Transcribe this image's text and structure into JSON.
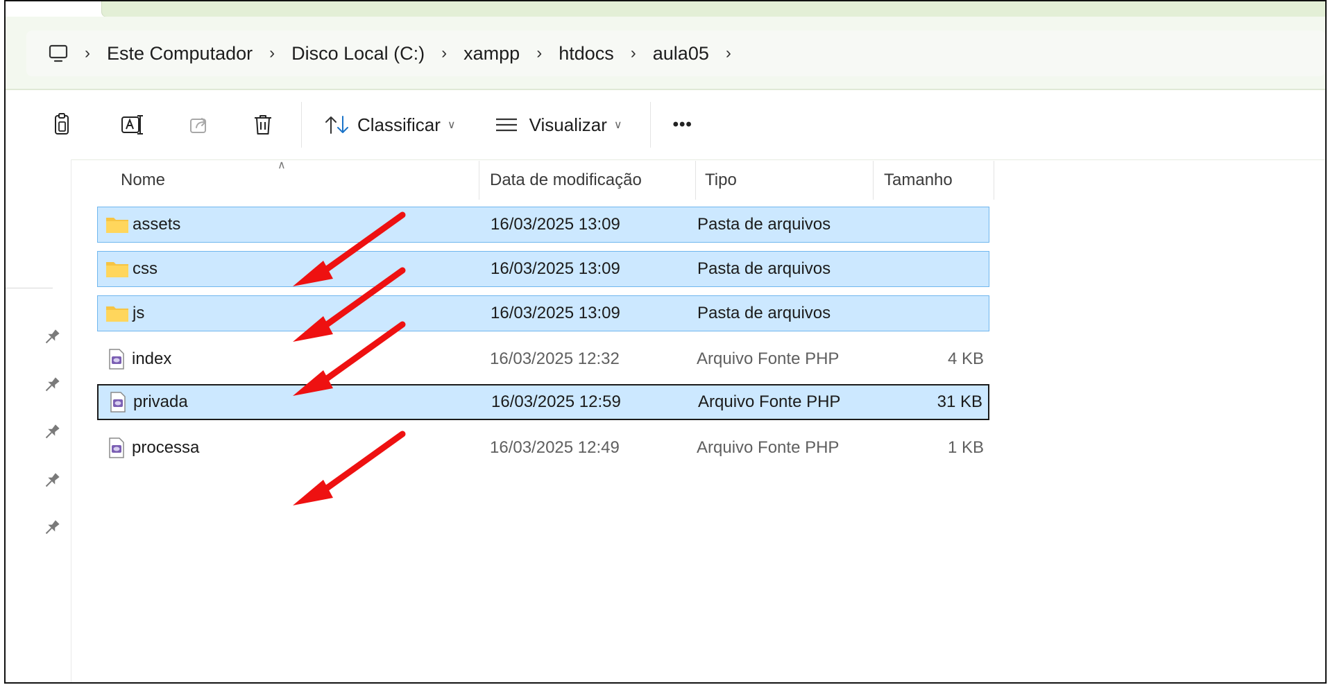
{
  "breadcrumb": {
    "root_icon": "computer-icon",
    "items": [
      "Este Computador",
      "Disco Local (C:)",
      "xampp",
      "htdocs",
      "aula05"
    ]
  },
  "toolbar": {
    "icons": [
      "copy-icon",
      "rename-icon",
      "share-icon",
      "delete-icon"
    ],
    "sort_label": "Classificar",
    "view_label": "Visualizar",
    "more_label": "•••"
  },
  "columns": {
    "name": "Nome",
    "date": "Data de modificação",
    "type": "Tipo",
    "size": "Tamanho"
  },
  "files": [
    {
      "name": "assets",
      "date": "16/03/2025 13:09",
      "type": "Pasta de arquivos",
      "size": "",
      "icon": "folder-icon"
    },
    {
      "name": "css",
      "date": "16/03/2025 13:09",
      "type": "Pasta de arquivos",
      "size": "",
      "icon": "folder-icon"
    },
    {
      "name": "js",
      "date": "16/03/2025 13:09",
      "type": "Pasta de arquivos",
      "size": "",
      "icon": "folder-icon"
    },
    {
      "name": "index",
      "date": "16/03/2025 12:32",
      "type": "Arquivo Fonte PHP",
      "size": "4 KB",
      "icon": "php-file-icon"
    },
    {
      "name": "privada",
      "date": "16/03/2025 12:59",
      "type": "Arquivo Fonte PHP",
      "size": "31 KB",
      "icon": "php-file-icon"
    },
    {
      "name": "processa",
      "date": "16/03/2025 12:49",
      "type": "Arquivo Fonte PHP",
      "size": "1 KB",
      "icon": "php-file-icon"
    }
  ],
  "colors": {
    "selection_bg": "#cce8ff",
    "selection_border": "#6fb6ee",
    "annotation_arrow": "#ee1111"
  }
}
